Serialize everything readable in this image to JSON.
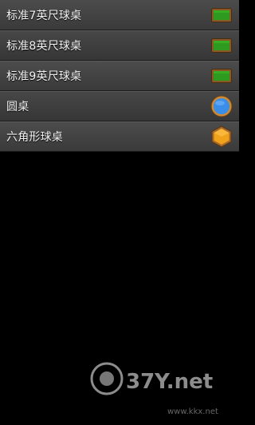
{
  "menu": {
    "items": [
      {
        "label": "标准7英尺球桌",
        "icon": "rectangular-table-icon"
      },
      {
        "label": "标准8英尺球桌",
        "icon": "rectangular-table-icon"
      },
      {
        "label": "标准9英尺球桌",
        "icon": "rectangular-table-icon"
      },
      {
        "label": "圆桌",
        "icon": "round-table-icon"
      },
      {
        "label": "六角形球桌",
        "icon": "hexagon-table-icon"
      }
    ]
  },
  "watermark": {
    "logo_text": "37Y.net",
    "url": "www.kkx.net"
  },
  "colors": {
    "felt_green": "#2e9a1f",
    "round_blue": "#3a8ee8",
    "hex_orange": "#f0a21a",
    "wood_border": "#a86a2c"
  }
}
